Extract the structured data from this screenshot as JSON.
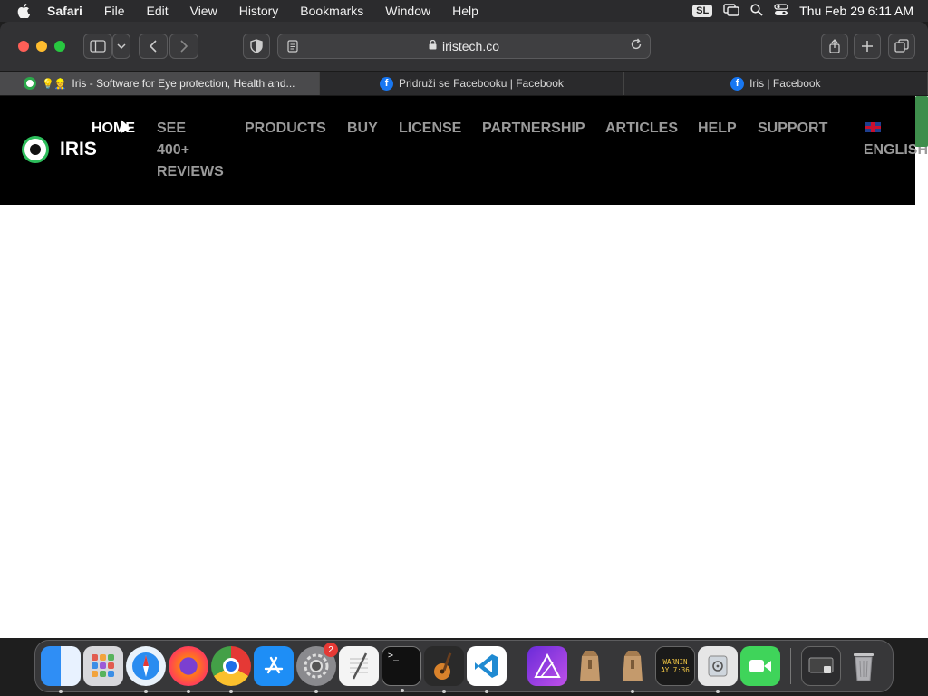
{
  "menubar": {
    "app_name": "Safari",
    "items": [
      "File",
      "Edit",
      "View",
      "History",
      "Bookmarks",
      "Window",
      "Help"
    ],
    "input_source": "SL",
    "datetime": "Thu Feb 29  6:11 AM"
  },
  "browser": {
    "url": "iristech.co",
    "tabs": [
      {
        "label": "Iris - Software for Eye protection, Health and...",
        "active": true,
        "icon": "iris-favicon"
      },
      {
        "label": "Pridruži se Facebooku | Facebook",
        "active": false,
        "icon": "facebook-icon"
      },
      {
        "label": "Iris | Facebook",
        "active": false,
        "icon": "facebook-icon"
      }
    ]
  },
  "site": {
    "logo_text": "IRIS",
    "nav": {
      "home": "HOME",
      "reviews_1": "SEE",
      "reviews_2": "400+",
      "reviews_3": "REVIEWS",
      "products": "PRODUCTS",
      "buy": "BUY",
      "license": "LICENSE",
      "partnership": "PARTNERSHIP",
      "articles": "ARTICLES",
      "help": "HELP",
      "support": "SUPPORT",
      "language": "ENGLISH"
    }
  },
  "dock": {
    "apps": [
      "Finder",
      "Launchpad",
      "Safari",
      "Firefox",
      "Chrome",
      "App Store",
      "System Preferences",
      "TextEdit",
      "Terminal",
      "GarageBand",
      "VS Code",
      "Affinity Designer",
      "Archive Utility",
      "Archive Utility",
      "Console",
      "Disk Utility",
      "FaceTime",
      "Screenshot",
      "Trash"
    ],
    "settings_badge": "2",
    "console_label": "WARNIN\nAY 7:36"
  },
  "colors": {
    "accent_green": "#2dbd5b",
    "nav_bg": "#000000",
    "nav_text": "#9a9a9a"
  }
}
